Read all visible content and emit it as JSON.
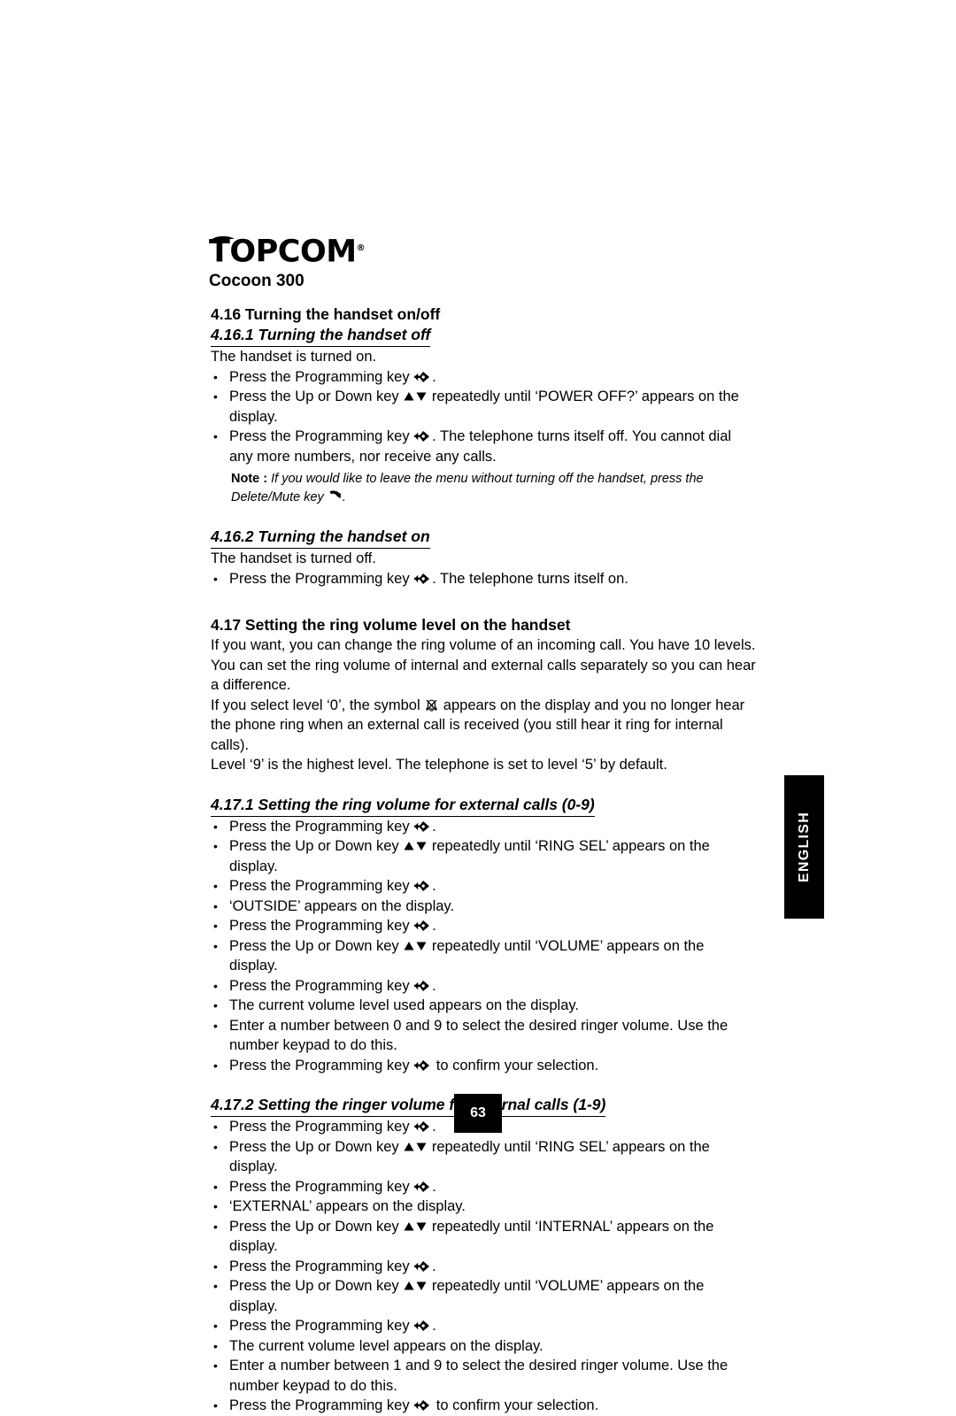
{
  "document": {
    "brand": "TOPCOM",
    "brand_registered_mark": "®",
    "model": "Cocoon 300",
    "page_number": "63",
    "language_tab": "ENGLISH"
  },
  "icons": {
    "programming_key": "programming-key-icon",
    "up_down_key": "up-down-arrow-key-icon",
    "delete_mute_key": "delete-mute-handset-key-icon",
    "ringer_off_symbol": "ringer-off-bell-icon"
  },
  "sections": [
    {
      "id": "sec-4-16",
      "number": "4.16",
      "heading": "4.16 Turning the handset on/off",
      "subsections": [
        {
          "id": "sub-4-16-1",
          "heading": "4.16.1 Turning the handset off",
          "intro": "The handset is turned on.",
          "bullets": [
            {
              "pre": "Press the Programming key ",
              "icon": "programming_key",
              "post": "."
            },
            {
              "pre": "Press the Up or Down key ",
              "icon": "up_down_key",
              "post": " repeatedly until ‘POWER OFF?’ appears on the display."
            },
            {
              "pre": "Press the Programming key ",
              "icon": "programming_key",
              "post": ". The telephone turns itself off. You cannot dial any more numbers, nor receive any calls."
            }
          ],
          "note": {
            "label": "Note :",
            "text_pre": " If you would like to leave the menu without turning off the handset, press the Delete/Mute key ",
            "icon": "delete_mute_key",
            "text_post": "."
          }
        },
        {
          "id": "sub-4-16-2",
          "heading": "4.16.2 Turning the handset on",
          "intro": "The handset is turned off.",
          "bullets": [
            {
              "pre": "Press the Programming key ",
              "icon": "programming_key",
              "post": ". The telephone turns itself on."
            }
          ]
        }
      ]
    },
    {
      "id": "sec-4-17",
      "number": "4.17",
      "heading": "4.17 Setting the ring volume level on the handset",
      "paragraphs": [
        {
          "pre": "If you want, you can change the ring volume of an incoming call. You have 10 levels. You can set the ring volume of internal and external calls separately so you can hear a difference.",
          "icon": null,
          "post": ""
        },
        {
          "pre": "If you select level ‘0’, the symbol ",
          "icon": "ringer_off_symbol",
          "post": " appears on the display and you no longer hear the phone ring when an external call is received (you still hear it ring for internal calls)."
        },
        {
          "pre": "Level ‘9’ is the highest level. The telephone is set to level ‘5’ by default.",
          "icon": null,
          "post": ""
        }
      ],
      "subsections": [
        {
          "id": "sub-4-17-1",
          "heading": "4.17.1 Setting the ring volume for external calls (0-9)",
          "bullets": [
            {
              "pre": "Press the Programming key ",
              "icon": "programming_key",
              "post": "."
            },
            {
              "pre": "Press the Up or Down key ",
              "icon": "up_down_key",
              "post": " repeatedly until ‘RING SEL’ appears on the display."
            },
            {
              "pre": "Press the Programming key ",
              "icon": "programming_key",
              "post": "."
            },
            {
              "pre": "‘OUTSIDE’ appears on the display.",
              "icon": null,
              "post": ""
            },
            {
              "pre": "Press the Programming key ",
              "icon": "programming_key",
              "post": "."
            },
            {
              "pre": "Press the Up or Down key ",
              "icon": "up_down_key",
              "post": " repeatedly until ‘VOLUME’ appears on the display."
            },
            {
              "pre": "Press the Programming key ",
              "icon": "programming_key",
              "post": "."
            },
            {
              "pre": "The current volume level used appears on the display.",
              "icon": null,
              "post": ""
            },
            {
              "pre": "Enter a number between 0 and 9 to select the desired ringer volume. Use the number keypad to do this.",
              "icon": null,
              "post": ""
            },
            {
              "pre": "Press the Programming key ",
              "icon": "programming_key",
              "post": " to confirm your selection."
            }
          ]
        },
        {
          "id": "sub-4-17-2",
          "heading": "4.17.2 Setting the ringer volume for internal calls (1-9)",
          "bullets": [
            {
              "pre": "Press the Programming key ",
              "icon": "programming_key",
              "post": "."
            },
            {
              "pre": "Press the Up or Down key ",
              "icon": "up_down_key",
              "post": " repeatedly until ‘RING SEL’ appears on the display."
            },
            {
              "pre": "Press the Programming key ",
              "icon": "programming_key",
              "post": "."
            },
            {
              "pre": "‘EXTERNAL’ appears on the display.",
              "icon": null,
              "post": ""
            },
            {
              "pre": "Press the Up or Down key ",
              "icon": "up_down_key",
              "post": " repeatedly until ‘INTERNAL’ appears on the display."
            },
            {
              "pre": "Press the Programming key ",
              "icon": "programming_key",
              "post": "."
            },
            {
              "pre": "Press the Up or Down key ",
              "icon": "up_down_key",
              "post": " repeatedly until ‘VOLUME’ appears on the display."
            },
            {
              "pre": "Press the Programming key ",
              "icon": "programming_key",
              "post": "."
            },
            {
              "pre": "The current volume level appears on the display.",
              "icon": null,
              "post": ""
            },
            {
              "pre": "Enter a number between 1 and 9 to select the desired ringer volume. Use the number keypad to do this.",
              "icon": null,
              "post": ""
            },
            {
              "pre": "Press the Programming key ",
              "icon": "programming_key",
              "post": " to confirm your selection."
            }
          ]
        }
      ]
    }
  ],
  "colors": {
    "ink": "#000000",
    "paper": "#ffffff",
    "tab_background": "#000000",
    "tab_text": "#ffffff"
  }
}
